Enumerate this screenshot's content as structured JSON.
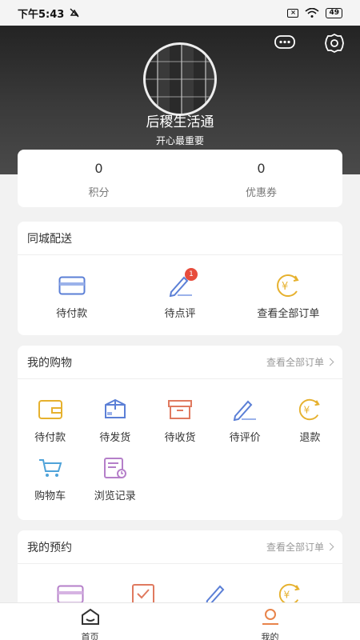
{
  "status_bar": {
    "time": "下午5:43",
    "battery": "49"
  },
  "profile": {
    "name": "后稷生活通",
    "tagline": "开心最重要"
  },
  "stats": [
    {
      "value": "0",
      "label": "积分"
    },
    {
      "value": "0",
      "label": "优惠券"
    }
  ],
  "local_delivery": {
    "title": "同城配送",
    "items": [
      {
        "label": "待付款",
        "icon": "card-icon"
      },
      {
        "label": "待点评",
        "icon": "pen-icon",
        "badge": "1"
      },
      {
        "label": "查看全部订单",
        "icon": "yen-icon"
      }
    ]
  },
  "my_shopping": {
    "title": "我的购物",
    "link": "查看全部订单",
    "items": [
      {
        "label": "待付款",
        "icon": "wallet-icon"
      },
      {
        "label": "待发货",
        "icon": "package-icon"
      },
      {
        "label": "待收货",
        "icon": "box-icon"
      },
      {
        "label": "待评价",
        "icon": "pen-icon"
      },
      {
        "label": "退款",
        "icon": "yen-icon"
      },
      {
        "label": "购物车",
        "icon": "cart-icon"
      },
      {
        "label": "浏览记录",
        "icon": "history-icon"
      }
    ]
  },
  "my_reservation": {
    "title": "我的预约",
    "link": "查看全部订单"
  },
  "tabbar": [
    {
      "label": "首页",
      "icon": "home-icon",
      "color": "#333333"
    },
    {
      "label": "我的",
      "icon": "profile-icon",
      "color": "#e8844a"
    }
  ]
}
